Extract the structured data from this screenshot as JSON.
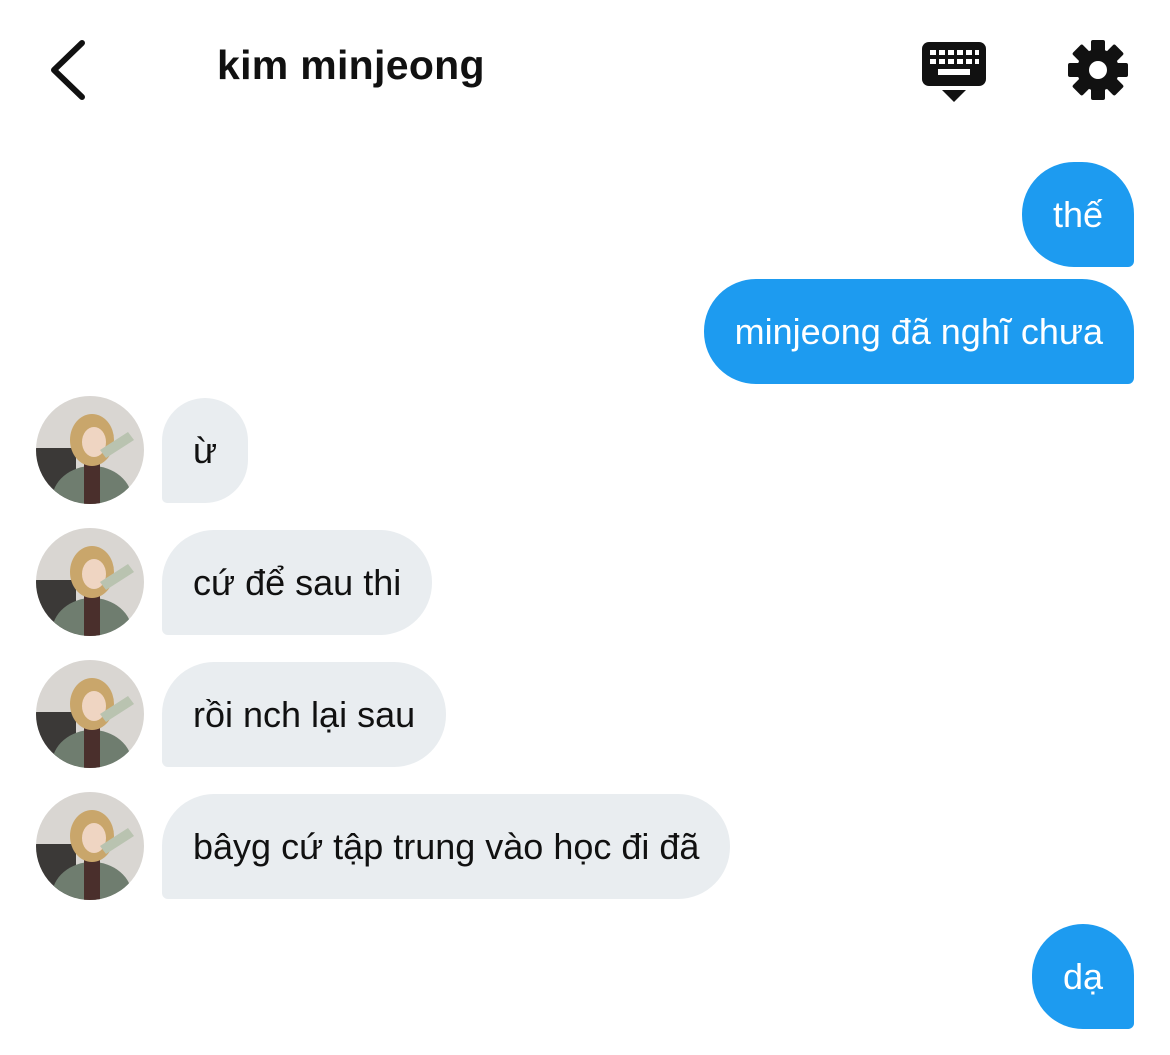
{
  "header": {
    "title": "kim minjeong",
    "back_icon": "chevron-left-icon",
    "keyboard_icon": "keyboard-icon",
    "settings_icon": "gear-icon"
  },
  "messages": [
    {
      "direction": "out",
      "text": "thế"
    },
    {
      "direction": "out",
      "text": "minjeong đã nghĩ chưa"
    },
    {
      "direction": "in",
      "text": "ừ"
    },
    {
      "direction": "in",
      "text": "cứ để sau thi"
    },
    {
      "direction": "in",
      "text": "rồi nch lại sau"
    },
    {
      "direction": "in",
      "text": "bâyg cứ tập trung vào học đi đã"
    },
    {
      "direction": "out",
      "text": "dạ"
    }
  ],
  "colors": {
    "outgoing_bubble": "#1d9bf0",
    "incoming_bubble": "#e9edf0",
    "text_dark": "#111111"
  }
}
